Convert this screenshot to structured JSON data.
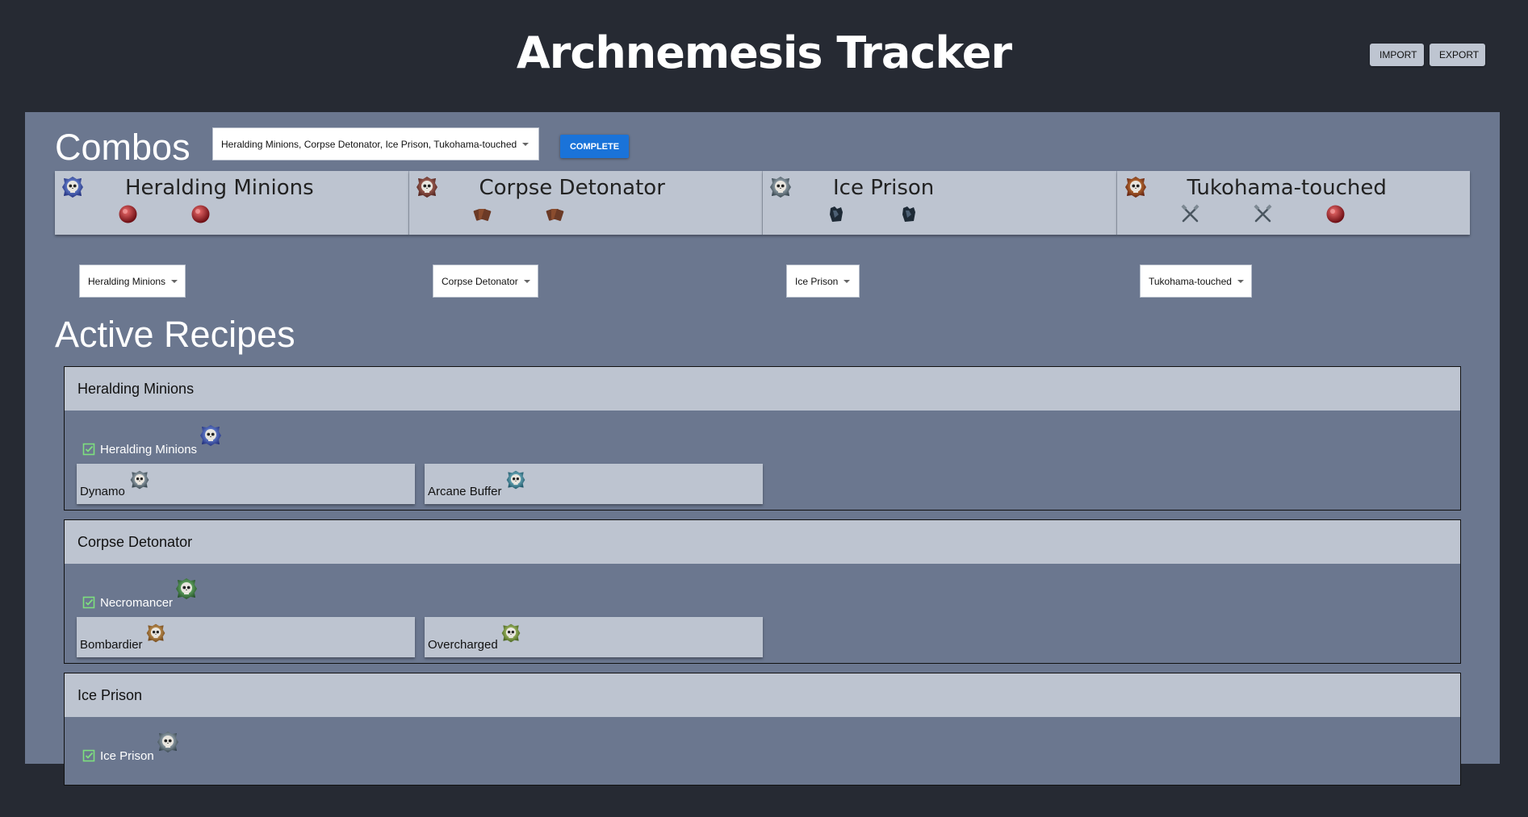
{
  "header": {
    "title": "Archnemesis Tracker",
    "import_label": "IMPORT",
    "export_label": "EXPORT"
  },
  "combos": {
    "title": "Combos",
    "selected": "Heralding Minions, Corpse Detonator, Ice Prison, Tukohama-touched",
    "complete_label": "COMPLETE",
    "cards": [
      {
        "name": "Heralding Minions",
        "icon": "heralding-minions-icon",
        "rewards": [
          "red-orb-icon",
          "red-orb-icon"
        ]
      },
      {
        "name": "Corpse Detonator",
        "icon": "corpse-detonator-icon",
        "rewards": [
          "card-deck-icon",
          "card-deck-icon"
        ]
      },
      {
        "name": "Ice Prison",
        "icon": "ice-prison-icon",
        "rewards": [
          "armour-icon",
          "armour-icon"
        ]
      },
      {
        "name": "Tukohama-touched",
        "icon": "tukohama-touched-icon",
        "rewards": [
          "crossed-tools-icon",
          "crossed-tools-icon",
          "red-orb-icon"
        ]
      }
    ],
    "selects": [
      "Heralding Minions",
      "Corpse Detonator",
      "Ice Prison",
      "Tukohama-touched"
    ]
  },
  "active_recipes": {
    "title": "Active Recipes",
    "recipes": [
      {
        "header": "Heralding Minions",
        "target": "Heralding Minions",
        "ingredients": [
          "Dynamo",
          "Arcane Buffer"
        ]
      },
      {
        "header": "Corpse Detonator",
        "target": "Necromancer",
        "ingredients": [
          "Bombardier",
          "Overcharged"
        ]
      },
      {
        "header": "Ice Prison",
        "target": "Ice Prison",
        "ingredients": []
      }
    ]
  },
  "colors": {
    "background": "#262a33",
    "panel": "#6b778f",
    "card": "#bdc4d0",
    "accent": "#1a73d9",
    "check": "#7ee07e"
  }
}
